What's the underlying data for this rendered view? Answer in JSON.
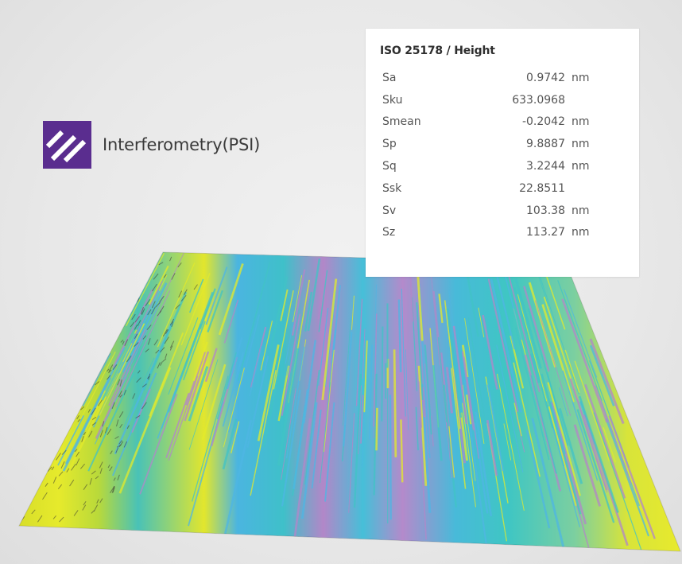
{
  "brand": {
    "logo_icon": "diagonal-stripes-icon",
    "logo_color": "#5a2d8f",
    "name": "Interferometry(PSI)"
  },
  "surface": {
    "description_icon": "surface-topography-3d-map",
    "palette": [
      "#e3e92b",
      "#42c3c6",
      "#4fb6e3",
      "#b287c8"
    ]
  },
  "stats": {
    "title": "ISO 25178 / Height",
    "rows": [
      {
        "name": "Sa",
        "value": "0.9742",
        "unit": "nm"
      },
      {
        "name": "Sku",
        "value": "633.0968",
        "unit": ""
      },
      {
        "name": "Smean",
        "value": "-0.2042",
        "unit": "nm"
      },
      {
        "name": "Sp",
        "value": "9.8887",
        "unit": "nm"
      },
      {
        "name": "Sq",
        "value": "3.2244",
        "unit": "nm"
      },
      {
        "name": "Ssk",
        "value": "22.8511",
        "unit": ""
      },
      {
        "name": "Sv",
        "value": "103.38",
        "unit": "nm"
      },
      {
        "name": "Sz",
        "value": "113.27",
        "unit": "nm"
      }
    ]
  }
}
